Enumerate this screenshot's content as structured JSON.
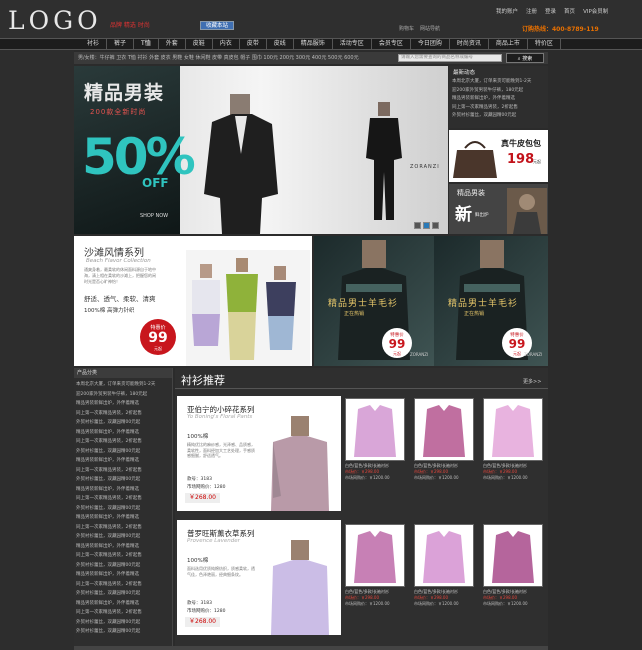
{
  "header": {
    "logo": "LOGO",
    "slogan": "品牌 精选 时尚",
    "favorite": "收藏本站",
    "top_links": [
      "我的账户",
      "注册",
      "登录",
      "首页",
      "VIP会员制"
    ],
    "mini_links": [
      "购物车",
      "网站导航"
    ],
    "hotline": "订购热线：400-8789-119"
  },
  "nav": {
    "items": [
      "衬衫",
      "裤子",
      "T恤",
      "外套",
      "皮鞋",
      "内衣",
      "皮带",
      "皮线",
      "精品服饰",
      "活动专区",
      "会员专区",
      "今日团购",
      "时尚资讯",
      "商品上市",
      "特价区"
    ],
    "active": 2
  },
  "filter": {
    "text": "男/女楼：牛仔裤 卫衣 T恤 衬衫 外套 皮衣 男鞋 女鞋 休闲鞋 皮带 真皮包 帽子 围巾   100元 200元 300元 400元 500元 600元",
    "search_placeholder": "请输入您需要查询的商品名称或编号",
    "search_button": "搜索"
  },
  "hero": {
    "title": "精品男装",
    "subtitle": "200款全新时尚",
    "percent": "50%",
    "off": "OFF",
    "shop_now": "SHOP NOW",
    "brand": "ZORANZI",
    "slides": [
      1,
      2,
      3
    ],
    "active_slide": 1
  },
  "news": {
    "title": "最新动态",
    "items": [
      "本周北京大厦，订单来货可能晚到1-2天",
      "迎200家外贸男装牛仔裤，180元起",
      "精品男装新鲜出炉，外伴着精选",
      "同上第一次家精品男装，2折起售",
      "外贸衬衫蕾丝，双藏园精00元起"
    ]
  },
  "bag": {
    "label": "真牛皮包包",
    "price": "198",
    "unit": "元起"
  },
  "men": {
    "label": "精品男装",
    "new": "新",
    "sale": "鲜出炉"
  },
  "beach": {
    "title": "沙滩风情系列",
    "en": "Beach Flavor Collection",
    "desc": "通爽身着，最柔软的休闲面料源自于地中海，清上相在柔软的沙滩上，把握您的闲时光是否心旷神怡！",
    "keywords": "舒适、透气、柔软、清爽",
    "cotton": "100%棉  高弹力针织",
    "badge_top": "特惠价",
    "badge_price": "99",
    "badge_unit": "元起"
  },
  "sweaters": [
    {
      "title": "精品男士羊毛衫",
      "sub": "正在热销",
      "badge_top": "特惠价",
      "badge_price": "99",
      "badge_unit": "元起",
      "brand": "ZORANZI"
    },
    {
      "title": "精品男士羊毛衫",
      "sub": "正在热销",
      "badge_top": "特惠价",
      "badge_price": "99",
      "badge_unit": "元起",
      "brand": "ZORANZI"
    }
  ],
  "categories": {
    "title": "产品分类",
    "items": [
      "本周北京大厦，订单来货可能晚到1-2天",
      "迎200家外贸男装牛仔裤，180元起",
      "精品男装新鲜出炉，外伴着精选",
      "同上第一次家精品男装，2折起售",
      "外贸衬衫蕾丝，双藏园精00元起",
      "精品男装新鲜出炉，外伴着精选",
      "同上第一次家精品男装，2折起售",
      "外贸衬衫蕾丝，双藏园精00元起",
      "精品男装新鲜出炉，外伴着精选",
      "同上第一次家精品男装，2折起售",
      "外贸衬衫蕾丝，双藏园精00元起",
      "精品男装新鲜出炉，外伴着精选",
      "同上第一次家精品男装，2折起售",
      "外贸衬衫蕾丝，双藏园精00元起",
      "精品男装新鲜出炉，外伴着精选",
      "同上第一次家精品男装，2折起售",
      "外贸衬衫蕾丝，双藏园精00元起",
      "精品男装新鲜出炉，外伴着精选",
      "同上第一次家精品男装，2折起售",
      "外贸衬衫蕾丝，双藏园精00元起",
      "精品男装新鲜出炉，外伴着精选",
      "同上第一次家精品男装，2折起售",
      "外贸衬衫蕾丝，双藏园精00元起",
      "精品男装新鲜出炉，外伴着精选",
      "同上第一次家精品男装，2折起售",
      "外贸衬衫蕾丝，双藏园精00元起",
      "外贸衬衫蕾丝，双藏园精00元起"
    ]
  },
  "shirts": {
    "title": "衬衫推荐",
    "more": "更多>>",
    "promos": [
      {
        "title": "亚伯宁的小碎花系列",
        "en": "Yo Boning's Floral Pants",
        "cotton": "100%棉",
        "desc": "精纯优比的麻纱感，光泽感、品质感，柔软性，面料经加大工艺处理，手感质感细腻，舒适透气。",
        "code": "款号：3183",
        "mkt": "市场网购价：1280",
        "price": "￥268.00"
      },
      {
        "title": "普罗旺斯薰衣草系列",
        "en": "Provence Lavender",
        "cotton": "100%棉",
        "desc": "面料选用优质纯棉纺织，质感柔软，透气佳，色泽艳丽，经典细条纹。",
        "code": "款号：3183",
        "mkt": "市场网购价：1280",
        "price": "￥268.00"
      }
    ],
    "products": [
      {
        "name": "白色/蓝色/多款/长袖衬衫",
        "price": "市场价：￥298.00",
        "mkt": "市场网购价：￥1200.00",
        "color": "#d9a6d8"
      },
      {
        "name": "白色/蓝色/多款/长袖衬衫",
        "price": "市场价：￥298.00",
        "mkt": "市场网购价：￥1200.00",
        "color": "#c06fa0"
      },
      {
        "name": "白色/蓝色/多款/长袖衬衫",
        "price": "市场价：￥298.00",
        "mkt": "市场网购价：￥1200.00",
        "color": "#e8b3df"
      },
      {
        "name": "白色/蓝色/多款/长袖衬衫",
        "price": "市场价：￥298.00",
        "mkt": "市场网购价：￥1200.00",
        "color": "#c780b5"
      },
      {
        "name": "白色/蓝色/多款/长袖衬衫",
        "price": "市场价：￥298.00",
        "mkt": "市场网购价：￥1200.00",
        "color": "#dba2d8"
      },
      {
        "name": "白色/蓝色/多款/长袖衬衫",
        "price": "市场价：￥298.00",
        "mkt": "市场网购价：￥1200.00",
        "color": "#b5659c"
      }
    ]
  }
}
